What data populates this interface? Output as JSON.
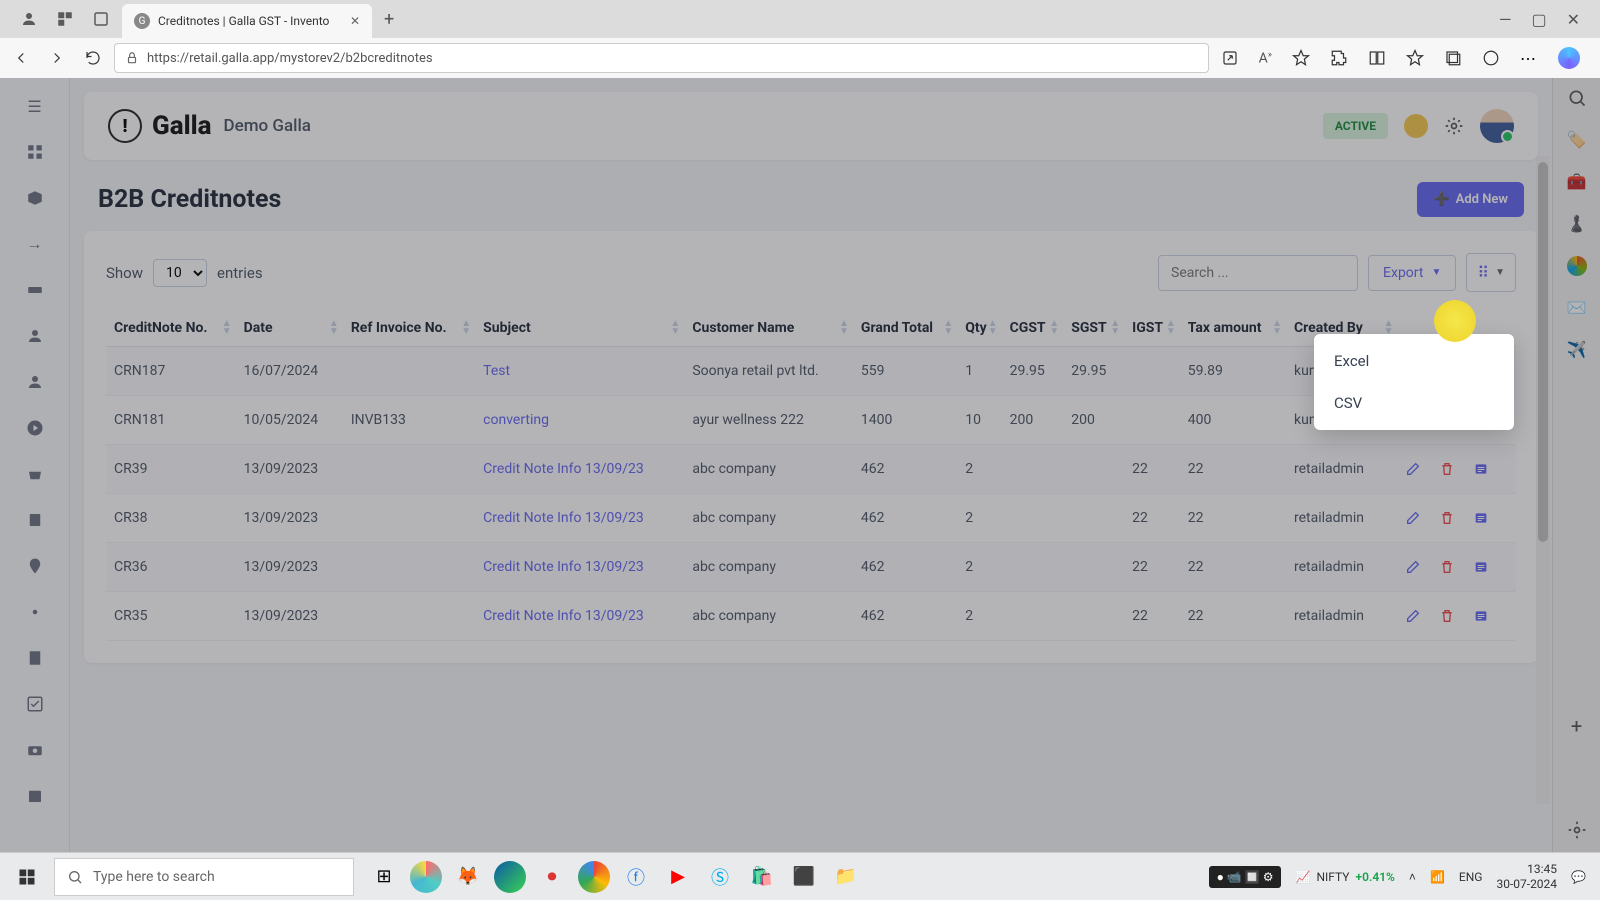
{
  "browser": {
    "tab_title": "Creditnotes | Galla GST - Invento",
    "url": "https://retail.galla.app/mystorev2/b2bcreditnotes"
  },
  "header": {
    "logo_text": "Galla",
    "org_name": "Demo Galla",
    "status_badge": "ACTIVE"
  },
  "page": {
    "title": "B2B Creditnotes",
    "add_new_label": "Add New"
  },
  "table_controls": {
    "show_label": "Show",
    "page_size": "10",
    "entries_label": "entries",
    "search_placeholder": "Search ...",
    "export_label": "Export"
  },
  "export_menu": {
    "excel": "Excel",
    "csv": "CSV"
  },
  "columns": {
    "credit_no": "CreditNote No.",
    "date": "Date",
    "ref": "Ref Invoice No.",
    "subject": "Subject",
    "customer": "Customer Name",
    "grand": "Grand Total",
    "qty": "Qty",
    "cgst": "CGST",
    "sgst": "SGST",
    "igst": "IGST",
    "tax": "Tax amount",
    "created": "Created By"
  },
  "rows": [
    {
      "no": "CRN187",
      "date": "16/07/2024",
      "ref": "",
      "subject": "Test",
      "customer": "Soonya retail pvt ltd.",
      "grand": "559",
      "qty": "1",
      "cgst": "29.95",
      "sgst": "29.95",
      "igst": "",
      "tax": "59.89",
      "created": "kumaradmin"
    },
    {
      "no": "CRN181",
      "date": "10/05/2024",
      "ref": "INVB133",
      "subject": "converting",
      "customer": "ayur wellness 222",
      "grand": "1400",
      "qty": "10",
      "cgst": "200",
      "sgst": "200",
      "igst": "",
      "tax": "400",
      "created": "kumaradmin"
    },
    {
      "no": "CR39",
      "date": "13/09/2023",
      "ref": "",
      "subject": "Credit Note Info 13/09/23",
      "customer": "abc company",
      "grand": "462",
      "qty": "2",
      "cgst": "",
      "sgst": "",
      "igst": "22",
      "tax": "22",
      "created": "retailadmin"
    },
    {
      "no": "CR38",
      "date": "13/09/2023",
      "ref": "",
      "subject": "Credit Note Info 13/09/23",
      "customer": "abc company",
      "grand": "462",
      "qty": "2",
      "cgst": "",
      "sgst": "",
      "igst": "22",
      "tax": "22",
      "created": "retailadmin"
    },
    {
      "no": "CR36",
      "date": "13/09/2023",
      "ref": "",
      "subject": "Credit Note Info 13/09/23",
      "customer": "abc company",
      "grand": "462",
      "qty": "2",
      "cgst": "",
      "sgst": "",
      "igst": "22",
      "tax": "22",
      "created": "retailadmin"
    },
    {
      "no": "CR35",
      "date": "13/09/2023",
      "ref": "",
      "subject": "Credit Note Info 13/09/23",
      "customer": "abc company",
      "grand": "462",
      "qty": "2",
      "cgst": "",
      "sgst": "",
      "igst": "22",
      "tax": "22",
      "created": "retailadmin"
    }
  ],
  "taskbar": {
    "search_placeholder": "Type here to search",
    "stock_name": "NIFTY",
    "stock_change": "+0.41%",
    "lang": "ENG",
    "time": "13:45",
    "date": "30-07-2024"
  }
}
